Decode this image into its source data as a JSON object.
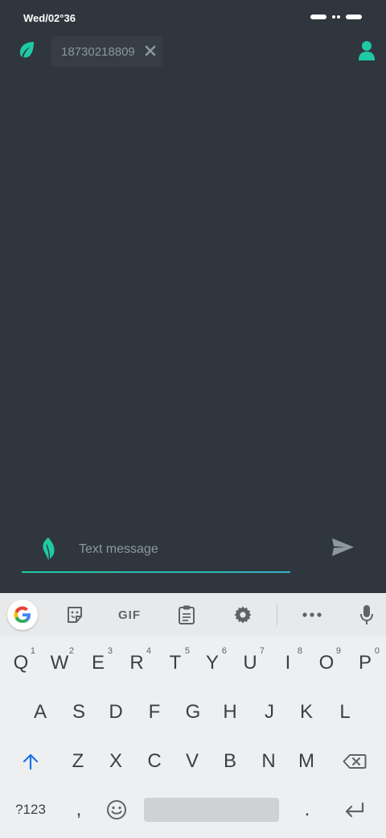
{
  "status_bar": {
    "time": "Wed/02°36"
  },
  "header": {
    "recipient": "18730218809",
    "icons": {
      "app": "leaf-icon",
      "chip_close": "close-icon",
      "contact": "person-icon"
    }
  },
  "composer": {
    "placeholder": "Text message",
    "icons": {
      "leaf": "leaf-icon",
      "send": "send-icon"
    }
  },
  "keyboard": {
    "toolbar": {
      "gif_label": "GIF",
      "icons": [
        "google-g-icon",
        "sticker-icon",
        "gif-icon",
        "clipboard-icon",
        "gear-icon",
        "more-icon",
        "mic-icon"
      ]
    },
    "row1": [
      {
        "key": "Q",
        "hint": "1"
      },
      {
        "key": "W",
        "hint": "2"
      },
      {
        "key": "E",
        "hint": "3"
      },
      {
        "key": "R",
        "hint": "4"
      },
      {
        "key": "T",
        "hint": "5"
      },
      {
        "key": "Y",
        "hint": "6"
      },
      {
        "key": "U",
        "hint": "7"
      },
      {
        "key": "I",
        "hint": "8"
      },
      {
        "key": "O",
        "hint": "9"
      },
      {
        "key": "P",
        "hint": "0"
      }
    ],
    "row2": [
      "A",
      "S",
      "D",
      "F",
      "G",
      "H",
      "J",
      "K",
      "L"
    ],
    "row3": [
      "Z",
      "X",
      "C",
      "V",
      "B",
      "N",
      "M"
    ],
    "row4": {
      "symbols": "?123",
      "comma": ",",
      "period": "."
    },
    "colors": {
      "accent": "#1fc9a4",
      "shift": "#1a73e8",
      "background": "#30363d"
    }
  }
}
